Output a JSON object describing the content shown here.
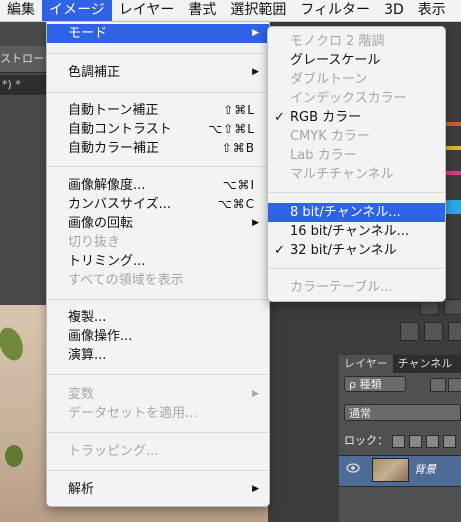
{
  "menubar": {
    "items": [
      {
        "label": "編集"
      },
      {
        "label": "イメージ"
      },
      {
        "label": "レイヤー"
      },
      {
        "label": "書式"
      },
      {
        "label": "選択範囲"
      },
      {
        "label": "フィルター"
      },
      {
        "label": "3D"
      },
      {
        "label": "表示"
      }
    ]
  },
  "background": {
    "toolbar_fragment": "ストローク",
    "doc_tab_fragment": "*) *"
  },
  "image_menu": {
    "mode": "モード",
    "adjustments": "色調補正",
    "auto_tone": {
      "label": "自動トーン補正",
      "shortcut": "⇧⌘L"
    },
    "auto_contrast": {
      "label": "自動コントラスト",
      "shortcut": "⌥⇧⌘L"
    },
    "auto_color": {
      "label": "自動カラー補正",
      "shortcut": "⇧⌘B"
    },
    "image_size": {
      "label": "画像解像度...",
      "shortcut": "⌥⌘I"
    },
    "canvas_size": {
      "label": "カンバスサイズ...",
      "shortcut": "⌥⌘C"
    },
    "rotation": "画像の回転",
    "crop": "切り抜き",
    "trim": "トリミング...",
    "reveal_all": "すべての領域を表示",
    "duplicate": "複製...",
    "apply_image": "画像操作...",
    "calculations": "演算...",
    "variables": "変数",
    "apply_dataset": "データセットを適用...",
    "trap": "トラッピング...",
    "analysis": "解析"
  },
  "mode_submenu": {
    "bitmap": "モノクロ 2 階調",
    "grayscale": "グレースケール",
    "duotone": "ダブルトーン",
    "indexed": "インデックスカラー",
    "rgb": "RGB カラー",
    "cmyk": "CMYK カラー",
    "lab": "Lab カラー",
    "multichannel": "マルチチャンネル",
    "bit8": "8 bit/チャンネル...",
    "bit16": "16 bit/チャンネル...",
    "bit32": "32 bit/チャンネル",
    "color_table": "カラーテーブル...",
    "checkmark": "✓"
  },
  "layers_panel": {
    "tabs": [
      "レイヤー",
      "チャンネル"
    ],
    "filter_label": "ρ 種類",
    "blend_mode": "通常",
    "lock_label": "ロック：",
    "layer_name": "背景"
  },
  "colors": {
    "highlight": "#2e63e6",
    "menu_bg": "#f3f3f3",
    "disabled_text": "#a6a6a6"
  }
}
